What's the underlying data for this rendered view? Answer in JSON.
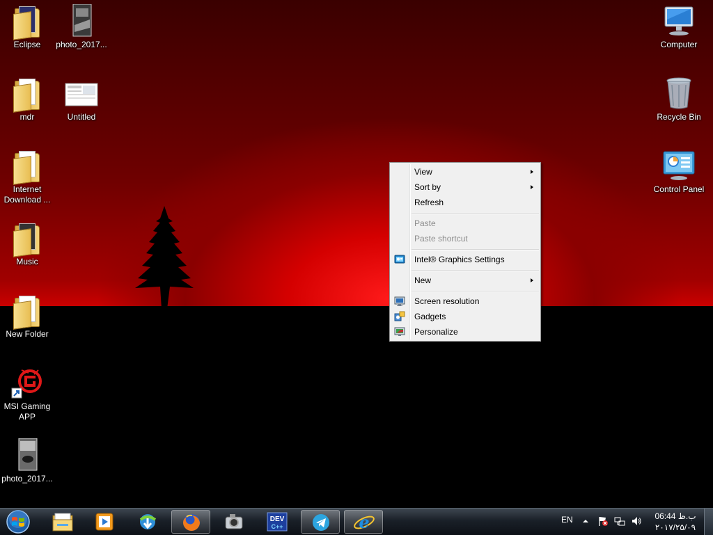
{
  "desktop_icons": [
    {
      "label": "Eclipse",
      "icon": "folder-icon"
    },
    {
      "label": "photo_2017...",
      "icon": "photo-thumbnail"
    },
    {
      "label": "mdr",
      "icon": "folder-icon"
    },
    {
      "label": "Untitled",
      "icon": "document-thumbnail"
    },
    {
      "label": "Internet Download ...",
      "icon": "folder-icon"
    },
    {
      "label": "Music",
      "icon": "folder-icon"
    },
    {
      "label": "New Folder",
      "icon": "folder-icon"
    },
    {
      "label": "MSI Gaming APP",
      "icon": "msi-dragon-icon"
    },
    {
      "label": "photo_2017...",
      "icon": "photo-thumbnail"
    },
    {
      "label": "Computer",
      "icon": "computer-icon"
    },
    {
      "label": "Recycle Bin",
      "icon": "recycle-bin-icon"
    },
    {
      "label": "Control Panel",
      "icon": "control-panel-icon"
    }
  ],
  "context_menu": {
    "items": [
      {
        "label": "View",
        "submenu": true,
        "enabled": true
      },
      {
        "label": "Sort by",
        "submenu": true,
        "enabled": true
      },
      {
        "label": "Refresh",
        "submenu": false,
        "enabled": true
      },
      {
        "label": "Paste",
        "submenu": false,
        "enabled": false
      },
      {
        "label": "Paste shortcut",
        "submenu": false,
        "enabled": false
      },
      {
        "label": "Intel® Graphics Settings",
        "submenu": false,
        "enabled": true,
        "icon": "intel-graphics-icon"
      },
      {
        "label": "New",
        "submenu": true,
        "enabled": true
      },
      {
        "label": "Screen resolution",
        "submenu": false,
        "enabled": true,
        "icon": "screen-resolution-icon"
      },
      {
        "label": "Gadgets",
        "submenu": false,
        "enabled": true,
        "icon": "gadgets-icon"
      },
      {
        "label": "Personalize",
        "submenu": false,
        "enabled": true,
        "icon": "personalize-icon"
      }
    ]
  },
  "taskbar": {
    "pinned": [
      "windows-explorer-icon",
      "media-player-icon",
      "internet-download-manager-icon",
      "firefox-icon",
      "camera-tool-icon",
      "devcpp-icon",
      "telegram-icon",
      "internet-explorer-icon"
    ],
    "active": [
      "firefox-icon",
      "telegram-icon",
      "internet-explorer-icon"
    ],
    "devcpp_badge": "DEV",
    "language": "EN",
    "clock_time": "06:44 ب.ظ",
    "clock_date": "۲۰۱۷/۲۵/۰۹"
  },
  "colors": {
    "desktop_red": "#d40000",
    "menu_bg": "#f0f0f0",
    "taskbar": "#1a2028"
  }
}
